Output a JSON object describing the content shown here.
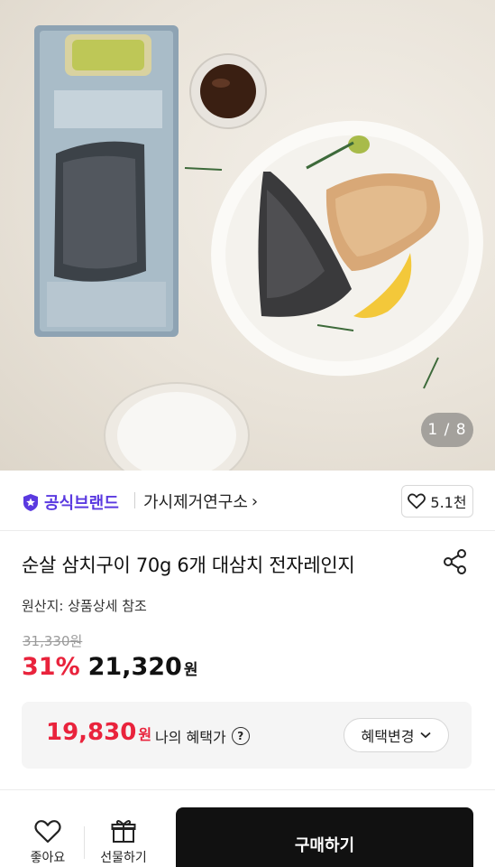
{
  "image": {
    "counter": "1 / 8"
  },
  "brand": {
    "badge_label": "공식브랜드",
    "store_name": "가시제거연구소",
    "store_chevron": "›",
    "like_count": "5.1천",
    "badge_color": "#5a39e0"
  },
  "product": {
    "title": "순살 삼치구이 70g 6개 대삼치 전자레인지",
    "origin": "원산지: 상품상세 참조",
    "original_price": "31,330원",
    "discount": "31%",
    "price": "21,320",
    "price_unit": "원",
    "discount_color": "#e9233c"
  },
  "benefit": {
    "price": "19,830",
    "price_unit": "원",
    "label": "나의 혜택가",
    "help_glyph": "?",
    "change_label": "혜택변경"
  },
  "bottom_bar": {
    "like_label": "좋아요",
    "gift_label": "선물하기",
    "buy_label": "구매하기"
  },
  "icons": [
    "shield-star-icon",
    "heart-icon",
    "share-icon",
    "help-icon",
    "chevron-down-icon",
    "gift-icon"
  ]
}
